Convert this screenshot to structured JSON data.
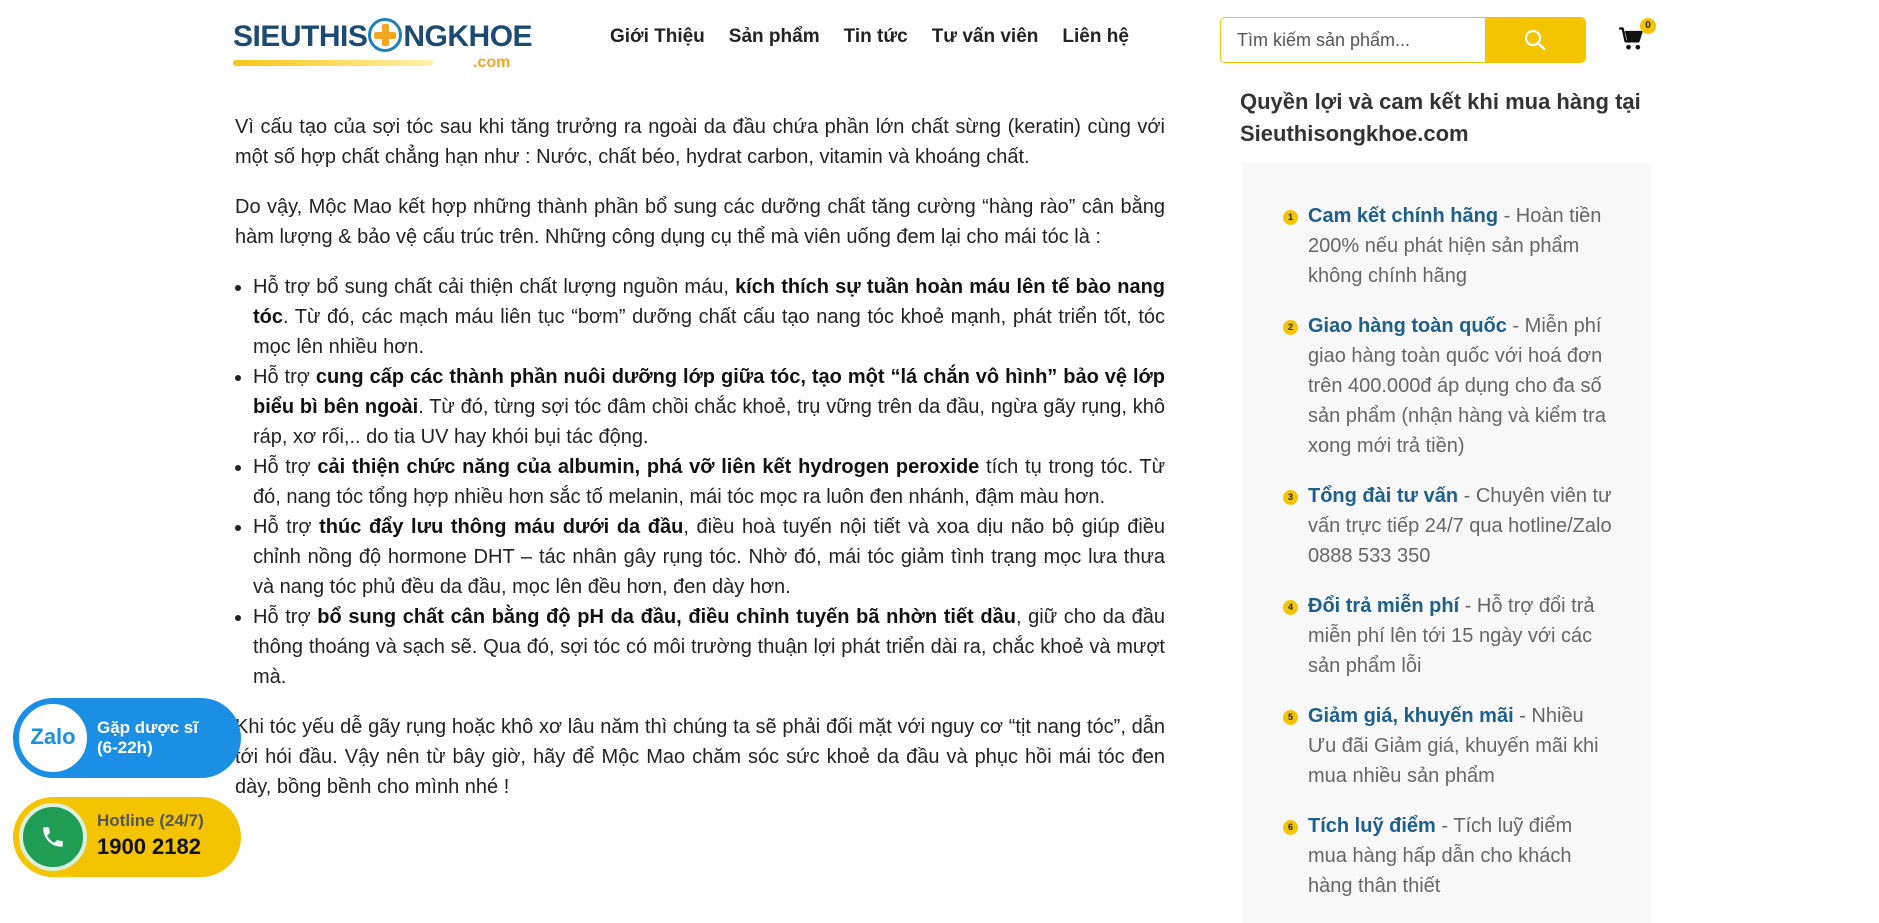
{
  "header": {
    "logo": {
      "text_a": "SIEUTHIS",
      "text_b": "NGKHOE",
      "suffix": ".com"
    },
    "nav": [
      "Giới Thiệu",
      "Sản phẩm",
      "Tin tức",
      "Tư vấn viên",
      "Liên hệ"
    ],
    "search_placeholder": "Tìm kiếm sản phẩm...",
    "cart_count": "0",
    "colors": {
      "accent": "#f5c400",
      "brand": "#1c4a73"
    },
    "icons": {
      "search": "search-icon",
      "cart": "cart-icon"
    }
  },
  "article": {
    "p1": "Vì cấu tạo của sợi tóc sau khi tăng trưởng ra ngoài da đầu chứa phần lớn chất sừng (keratin) cùng với một số hợp chất chẳng hạn như : Nước, chất béo, hydrat carbon, vitamin và khoáng chất.",
    "p2": "Do vậy, Mộc Mao kết hợp những thành phần bổ sung các dưỡng chất tăng cường “hàng rào” cân bằng hàm lượng & bảo vệ cấu trúc trên. Những công dụng cụ thể mà viên uống đem lại cho mái tóc là :",
    "bullets": [
      {
        "pre": "Hỗ trợ bổ sung chất cải thiện chất lượng nguồn máu, ",
        "bold": "kích thích sự tuần hoàn máu lên tế bào nang tóc",
        "post": ". Từ đó, các mạch máu liên tục “bơm” dưỡng chất cấu tạo nang tóc khoẻ mạnh, phát triển tốt, tóc mọc lên nhiều hơn."
      },
      {
        "pre": "Hỗ trợ ",
        "bold": "cung cấp các thành phần nuôi dưỡng lớp giữa tóc, tạo một “lá chắn vô hình” bảo vệ lớp biểu bì bên ngoài",
        "post": ". Từ đó, từng sợi tóc đâm chồi chắc khoẻ, trụ vững trên da đầu, ngừa gãy rụng, khô ráp, xơ rối,.. do tia UV hay khói bụi tác động."
      },
      {
        "pre": "Hỗ trợ ",
        "bold": "cải thiện chức năng của albumin, phá vỡ liên kết hydrogen peroxide",
        "post": " tích tụ trong tóc. Từ đó, nang tóc tổng hợp nhiều hơn sắc tố melanin, mái tóc mọc ra luôn đen nhánh, đậm màu hơn."
      },
      {
        "pre": "Hỗ trợ ",
        "bold": "thúc đẩy lưu thông máu dưới da đầu",
        "post": ", điều hoà tuyến nội tiết và xoa dịu não bộ giúp điều chỉnh nồng độ hormone DHT – tác nhân gây rụng tóc. Nhờ đó, mái tóc giảm tình trạng mọc lưa thưa và nang tóc phủ đều da đầu, mọc lên đều hơn, đen dày hơn."
      },
      {
        "pre": "Hỗ trợ ",
        "bold": "bổ sung chất cân bằng độ pH da đầu, điều chỉnh tuyến bã nhờn tiết dầu",
        "post": ", giữ cho da đầu thông thoáng và sạch sẽ. Qua đó, sợi tóc có môi trường thuận lợi phát triển dài ra, chắc khoẻ và mượt mà."
      }
    ],
    "p3": "Khi tóc yếu dễ gãy rụng hoặc khô xơ lâu năm thì chúng ta sẽ phải đối mặt với nguy cơ “tịt nang tóc”, dẫn tới hói đầu. Vậy nên từ bây giờ, hãy để Mộc Mao chăm sóc sức khoẻ da đầu và phục hồi mái tóc đen dày, bồng bềnh cho mình nhé !"
  },
  "sidebar": {
    "title": "Quyền lợi và cam kết khi mua hàng tại Sieuthisongkhoe.com",
    "items": [
      {
        "num": "1",
        "title": "Cam kết chính hãng",
        "desc": " - Hoàn tiền 200% nếu phát hiện sản phẩm không chính hãng"
      },
      {
        "num": "2",
        "title": "Giao hàng toàn quốc",
        "desc": " - Miễn phí giao hàng toàn quốc với hoá đơn trên 400.000đ áp dụng cho đa số sản phẩm (nhận hàng và kiểm tra xong mới trả tiền)"
      },
      {
        "num": "3",
        "title": "Tổng đài tư vấn",
        "desc": " - Chuyên viên tư vấn trực tiếp 24/7 qua hotline/Zalo 0888 533 350"
      },
      {
        "num": "4",
        "title": "Đổi trả miễn phí",
        "desc": " - Hỗ trợ đổi trả miễn phí lên tới 15 ngày với các sản phẩm lỗi"
      },
      {
        "num": "5",
        "title": "Giảm giá, khuyến mãi",
        "desc": " - Nhiều Ưu đãi Giảm giá, khuyến mãi khi mua nhiều sản phẩm"
      },
      {
        "num": "6",
        "title": "Tích luỹ điểm",
        "desc": " - Tích luỹ điểm mua hàng hấp dẫn cho khách hàng thân thiết"
      }
    ]
  },
  "floating": {
    "zalo": {
      "logo": "Zalo",
      "label_line1": "Gặp dược sĩ",
      "label_line2": "(6-22h)",
      "color": "#1a8fe3"
    },
    "hotline": {
      "label": "Hotline (24/7)",
      "number": "1900 2182",
      "color": "#f5c400",
      "icon": "phone-icon"
    }
  }
}
